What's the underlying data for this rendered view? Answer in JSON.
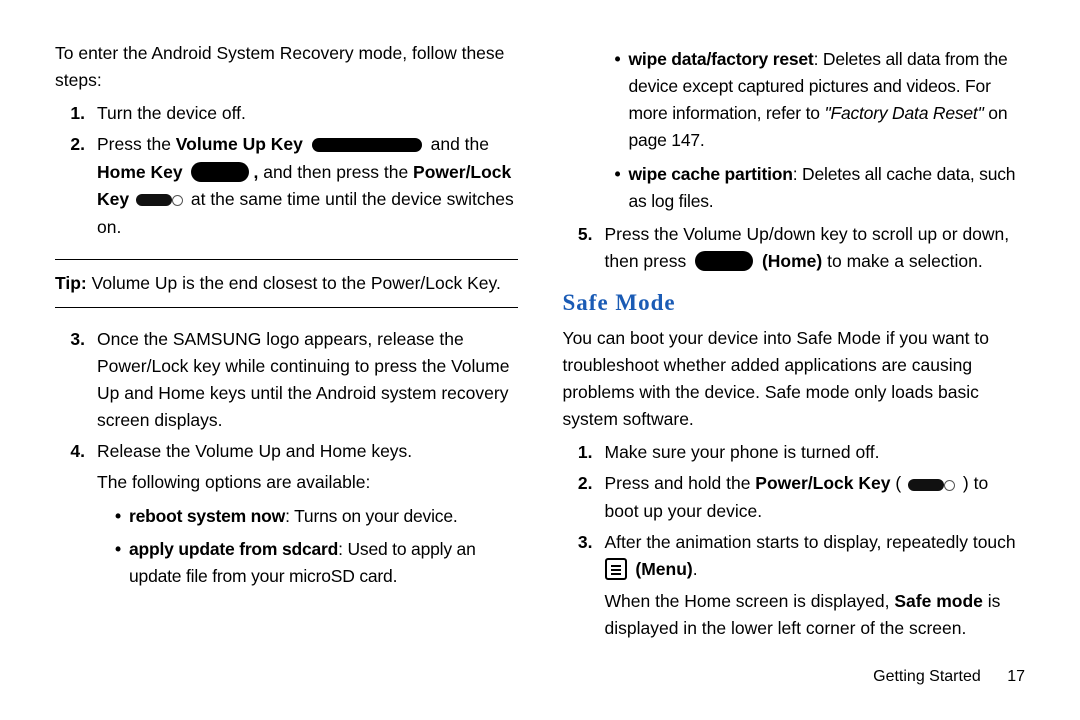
{
  "left": {
    "intro": "To enter the Android System Recovery mode, follow these steps:",
    "step1": "Turn the device off.",
    "step2_a": "Press the ",
    "step2_vup": "Volume Up Key",
    "step2_b": " and the ",
    "step2_home": "Home Key",
    "step2_c": " and then press the ",
    "step2_power": "Power/Lock Key",
    "step2_d": " at the same time until the device switches on.",
    "tip_label": "Tip:",
    "tip_text": " Volume Up is the end closest to the Power/Lock Key.",
    "step3": "Once the SAMSUNG logo appears, release the Power/Lock key while continuing to press the Volume Up and Home keys until the Android system recovery screen displays.",
    "step4_a": "Release the Volume Up and Home keys.",
    "step4_b": "The following options are available:",
    "opt1_b": "reboot system now",
    "opt1_t": ": Turns on your device.",
    "opt2_b": "apply update from sdcard",
    "opt2_t": ": Used to apply an update file from your microSD card."
  },
  "right": {
    "opt3_b": "wipe data/factory reset",
    "opt3_t": ": Deletes all data from the device except captured pictures and videos. For more information, refer to ",
    "opt3_ref": "\"Factory Data Reset\"",
    "opt3_pg": " on page 147.",
    "opt4_b": "wipe cache partition",
    "opt4_t": ": Deletes all cache data, such as log files.",
    "step5_a": "Press the Volume Up/down key to scroll up or down, then press ",
    "step5_home": "(Home)",
    "step5_b": " to make a selection.",
    "heading": "Safe Mode",
    "para": "You can boot your device into Safe Mode if you want to troubleshoot whether added applications are causing problems with the device. Safe mode only loads basic system software.",
    "sm1": "Make sure your phone is turned off.",
    "sm2_a": "Press and hold the ",
    "sm2_pl": "Power/Lock Key",
    "sm2_b": " ( ",
    "sm2_c": " ) to boot up your device.",
    "sm3_a": "After the animation starts to display, repeatedly touch ",
    "sm3_menu": "(Menu)",
    "sm3_dot": ".",
    "sm3_b1": "When the Home screen is displayed, ",
    "sm3_safe": "Safe mode",
    "sm3_b2": " is displayed in the lower left corner of the screen."
  },
  "footer": {
    "section": "Getting Started",
    "page": "17"
  }
}
